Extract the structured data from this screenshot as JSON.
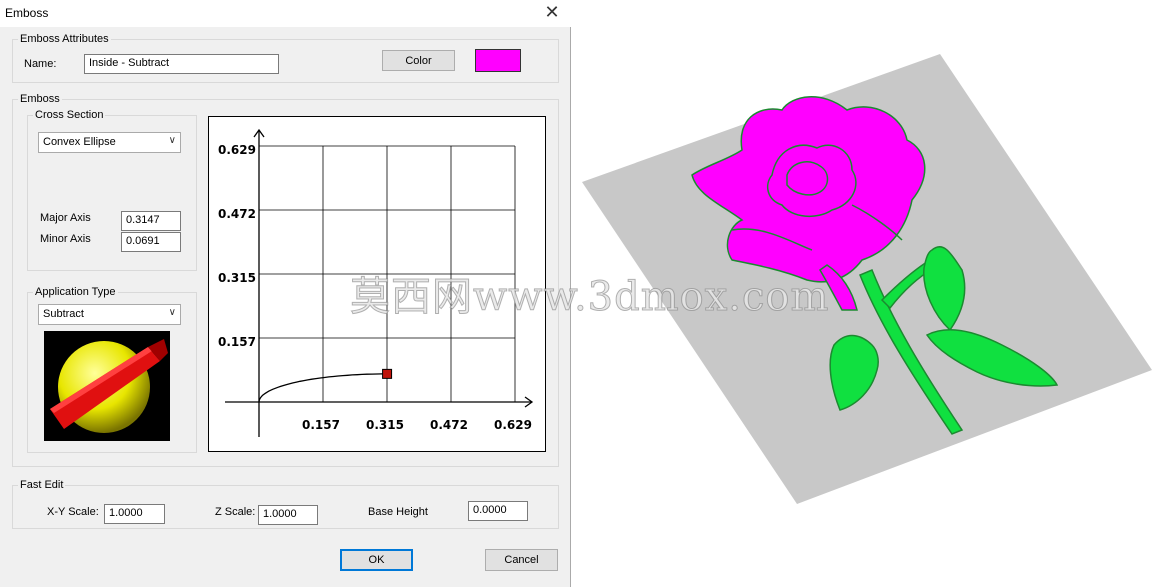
{
  "window": {
    "title": "Emboss",
    "close_glyph": "✕"
  },
  "attributes": {
    "legend": "Emboss Attributes",
    "name_label": "Name:",
    "name_value": "Inside - Subtract",
    "color_button": "Color",
    "color_value": "#ff00ff"
  },
  "emboss": {
    "legend": "Emboss",
    "cross_section": {
      "legend": "Cross Section",
      "selected": "Convex Ellipse",
      "major_label": "Major Axis",
      "major_value": "0.3147",
      "minor_label": "Minor Axis",
      "minor_value": "0.0691"
    },
    "application": {
      "legend": "Application Type",
      "selected": "Subtract"
    }
  },
  "chart_data": {
    "type": "line",
    "x_ticks": [
      "0.157",
      "0.315",
      "0.472",
      "0.629"
    ],
    "y_ticks": [
      "0.629",
      "0.472",
      "0.315",
      "0.157"
    ],
    "xlim": [
      0,
      0.629
    ],
    "ylim": [
      0,
      0.629
    ],
    "grid": true,
    "curve": {
      "type": "quarter-ellipse",
      "major": 0.3147,
      "minor": 0.0691
    },
    "handle": {
      "x": 0.3147,
      "y": 0.0691,
      "color": "#c0140c"
    }
  },
  "fast_edit": {
    "legend": "Fast Edit",
    "xy_label": "X-Y Scale:",
    "xy_value": "1.0000",
    "z_label": "Z Scale:",
    "z_value": "1.0000",
    "base_label": "Base Height",
    "base_value": "0.0000"
  },
  "buttons": {
    "ok": "OK",
    "cancel": "Cancel"
  },
  "watermark": "莫西网www.3dmox.com",
  "colors": {
    "rose": "#ff00ff",
    "leaf": "#00ee44",
    "plate": "#c8c8c8"
  }
}
